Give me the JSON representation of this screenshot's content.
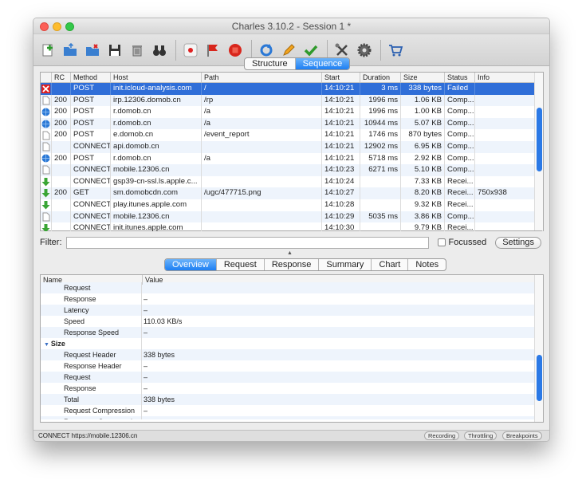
{
  "window": {
    "title": "Charles 3.10.2 - Session 1 *"
  },
  "toolbar": {
    "buttons": [
      {
        "name": "new-session-icon"
      },
      {
        "name": "open-session-icon"
      },
      {
        "name": "close-session-icon"
      },
      {
        "name": "save-icon"
      },
      {
        "name": "trash-icon"
      },
      {
        "name": "binoculars-icon"
      },
      {
        "name": "record-icon"
      },
      {
        "name": "throttle-flag-icon"
      },
      {
        "name": "stop-icon"
      },
      {
        "name": "repeat-icon"
      },
      {
        "name": "edit-pencil-icon"
      },
      {
        "name": "validate-check-icon"
      },
      {
        "name": "tools-icon"
      },
      {
        "name": "settings-gear-icon"
      },
      {
        "name": "shopping-cart-icon"
      }
    ]
  },
  "view_tabs": {
    "structure": "Structure",
    "sequence": "Sequence",
    "active": "Sequence"
  },
  "table": {
    "headers": {
      "rc": "RC",
      "method": "Method",
      "host": "Host",
      "path": "Path",
      "start": "Start",
      "duration": "Duration",
      "size": "Size",
      "status": "Status",
      "info": "Info"
    },
    "rows": [
      {
        "icon": "error",
        "rc": "",
        "method": "POST",
        "host": "init.icloud-analysis.com",
        "path": "/",
        "start": "14:10:21",
        "duration": "3 ms",
        "size": "338 bytes",
        "status": "Failed",
        "info": "",
        "selected": true
      },
      {
        "icon": "doc",
        "rc": "200",
        "method": "POST",
        "host": "irp.12306.domob.cn",
        "path": "/rp",
        "start": "14:10:21",
        "duration": "1996 ms",
        "size": "1.06 KB",
        "status": "Comp...",
        "info": ""
      },
      {
        "icon": "globe",
        "rc": "200",
        "method": "POST",
        "host": "r.domob.cn",
        "path": "/a",
        "start": "14:10:21",
        "duration": "1996 ms",
        "size": "1.00 KB",
        "status": "Comp...",
        "info": ""
      },
      {
        "icon": "globe",
        "rc": "200",
        "method": "POST",
        "host": "r.domob.cn",
        "path": "/a",
        "start": "14:10:21",
        "duration": "10944 ms",
        "size": "5.07 KB",
        "status": "Comp...",
        "info": ""
      },
      {
        "icon": "doc",
        "rc": "200",
        "method": "POST",
        "host": "e.domob.cn",
        "path": "/event_report",
        "start": "14:10:21",
        "duration": "1746 ms",
        "size": "870 bytes",
        "status": "Comp...",
        "info": ""
      },
      {
        "icon": "doc",
        "rc": "",
        "method": "CONNECT",
        "host": "api.domob.cn",
        "path": "",
        "start": "14:10:21",
        "duration": "12902 ms",
        "size": "6.95 KB",
        "status": "Comp...",
        "info": ""
      },
      {
        "icon": "globe",
        "rc": "200",
        "method": "POST",
        "host": "r.domob.cn",
        "path": "/a",
        "start": "14:10:21",
        "duration": "5718 ms",
        "size": "2.92 KB",
        "status": "Comp...",
        "info": ""
      },
      {
        "icon": "doc",
        "rc": "",
        "method": "CONNECT",
        "host": "mobile.12306.cn",
        "path": "",
        "start": "14:10:23",
        "duration": "6271 ms",
        "size": "5.10 KB",
        "status": "Comp...",
        "info": ""
      },
      {
        "icon": "down",
        "rc": "",
        "method": "CONNECT",
        "host": "gsp39-cn-ssl.ls.apple.c...",
        "path": "",
        "start": "14:10:24",
        "duration": "",
        "size": "7.33 KB",
        "status": "Recei...",
        "info": ""
      },
      {
        "icon": "down",
        "rc": "200",
        "method": "GET",
        "host": "sm.domobcdn.com",
        "path": "/ugc/477715.png",
        "start": "14:10:27",
        "duration": "",
        "size": "8.20 KB",
        "status": "Recei...",
        "info": "750x938"
      },
      {
        "icon": "down",
        "rc": "",
        "method": "CONNECT",
        "host": "play.itunes.apple.com",
        "path": "",
        "start": "14:10:28",
        "duration": "",
        "size": "9.32 KB",
        "status": "Recei...",
        "info": ""
      },
      {
        "icon": "doc",
        "rc": "",
        "method": "CONNECT",
        "host": "mobile.12306.cn",
        "path": "",
        "start": "14:10:29",
        "duration": "5035 ms",
        "size": "3.86 KB",
        "status": "Comp...",
        "info": ""
      },
      {
        "icon": "down",
        "rc": "",
        "method": "CONNECT",
        "host": "init.itunes.apple.com",
        "path": "",
        "start": "14:10:30",
        "duration": "",
        "size": "9.79 KB",
        "status": "Recei...",
        "info": ""
      }
    ]
  },
  "filter": {
    "label": "Filter:",
    "value": "",
    "focussed_label": "Focussed",
    "settings_label": "Settings"
  },
  "detail_tabs": [
    "Overview",
    "Request",
    "Response",
    "Summary",
    "Chart",
    "Notes"
  ],
  "detail_active": "Overview",
  "overview": {
    "headers": {
      "name": "Name",
      "value": "Value"
    },
    "rows": [
      {
        "name": "Request",
        "value": "",
        "level": 2
      },
      {
        "name": "Response",
        "value": "–",
        "level": 2
      },
      {
        "name": "Latency",
        "value": "–",
        "level": 2
      },
      {
        "name": "Speed",
        "value": "110.03 KB/s",
        "level": 2
      },
      {
        "name": "Response Speed",
        "value": "–",
        "level": 2
      },
      {
        "name": "Size",
        "value": "",
        "level": 1
      },
      {
        "name": "Request Header",
        "value": "338 bytes",
        "level": 2
      },
      {
        "name": "Response Header",
        "value": "–",
        "level": 2
      },
      {
        "name": "Request",
        "value": "–",
        "level": 2
      },
      {
        "name": "Response",
        "value": "–",
        "level": 2
      },
      {
        "name": "Total",
        "value": "338 bytes",
        "level": 2
      },
      {
        "name": "Request Compression",
        "value": "–",
        "level": 2
      },
      {
        "name": "Response Compression",
        "value": "–",
        "level": 2
      }
    ]
  },
  "statusbar": {
    "text": "CONNECT https://mobile.12306.cn",
    "recording": "Recording",
    "throttling": "Throttling",
    "breakpoints": "Breakpoints"
  },
  "colors": {
    "accent": "#2f6ed8",
    "tab_active": "#1d7ff3"
  }
}
